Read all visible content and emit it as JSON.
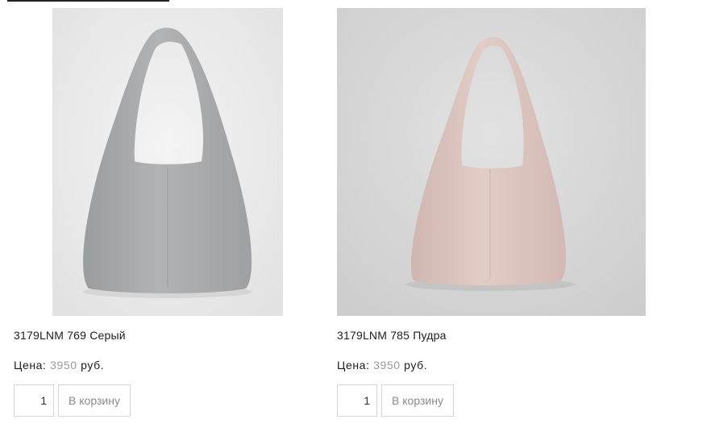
{
  "products": [
    {
      "name": "3179LNM 769 Серый",
      "price_label": "Цена:",
      "price_value": "3950",
      "currency": "руб.",
      "quantity": "1",
      "cart_button": "В корзину",
      "bag_color": "#a9aaab",
      "bg_color": "#ececec"
    },
    {
      "name": "3179LNM 785 Пудра",
      "price_label": "Цена:",
      "price_value": "3950",
      "currency": "руб.",
      "quantity": "1",
      "cart_button": "В корзину",
      "bag_color": "#dbc3bd",
      "bg_color": "#d7d7d7"
    }
  ]
}
